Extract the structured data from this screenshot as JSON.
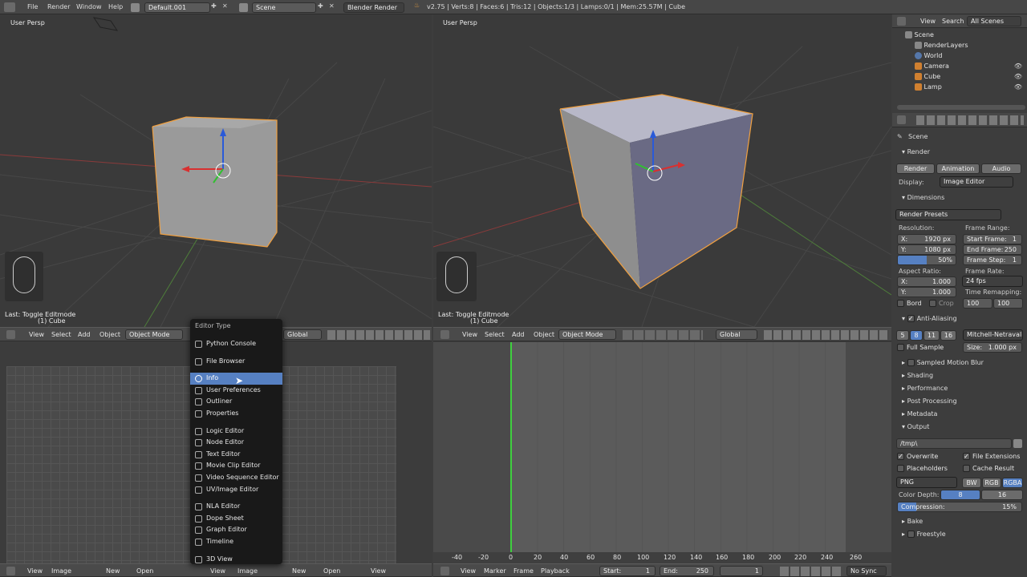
{
  "topbar": {
    "menus": [
      "File",
      "Render",
      "Window",
      "Help"
    ],
    "layout": "Default.001",
    "scene": "Scene",
    "engine": "Blender Render",
    "stats": "v2.75 | Verts:8 | Faces:6 | Tris:12 | Objects:1/3 | Lamps:0/1 | Mem:25.57M | Cube"
  },
  "viewport_left": {
    "label": "User Persp",
    "last_op": "Last: Toggle Editmode",
    "obj": "(1) Cube",
    "header": {
      "items": [
        "View",
        "Select",
        "Add",
        "Object"
      ],
      "mode": "Object Mode",
      "orient": "Global"
    }
  },
  "viewport_right": {
    "label": "User Persp",
    "last_op": "Last: Toggle Editmode",
    "obj": "(1) Cube",
    "header": {
      "items": [
        "View",
        "Select",
        "Add",
        "Object"
      ],
      "mode": "Object Mode",
      "orient": "Global"
    }
  },
  "image_editor": {
    "header": {
      "items": [
        "View",
        "Image",
        "New",
        "Open"
      ]
    }
  },
  "editor_menu": {
    "title": "Editor Type",
    "groups": [
      [
        "Python Console",
        "File Browser"
      ],
      [
        "Info",
        "User Preferences",
        "Outliner",
        "Properties"
      ],
      [
        "Logic Editor",
        "Node Editor",
        "Text Editor",
        "Movie Clip Editor",
        "Video Sequence Editor",
        "UV/Image Editor"
      ],
      [
        "NLA Editor",
        "Dope Sheet",
        "Graph Editor",
        "Timeline"
      ],
      [
        "3D View"
      ]
    ],
    "selected": "Info"
  },
  "bottom_mid_header": {
    "items": [
      "View",
      "Image",
      "New",
      "Open",
      "View"
    ]
  },
  "timeline": {
    "ticks": [
      "-40",
      "-20",
      "0",
      "20",
      "40",
      "60",
      "80",
      "100",
      "120",
      "140",
      "160",
      "180",
      "200",
      "220",
      "240",
      "260"
    ],
    "header": {
      "items": [
        "View",
        "Marker",
        "Frame",
        "Playback"
      ],
      "start_label": "Start:",
      "start": "1",
      "end_label": "End:",
      "end": "250",
      "current": "1",
      "sync": "No Sync"
    }
  },
  "outliner": {
    "tabs": [
      "View",
      "Search",
      "All Scenes"
    ],
    "items": [
      {
        "name": "Scene",
        "indent": 0
      },
      {
        "name": "RenderLayers",
        "indent": 1
      },
      {
        "name": "World",
        "indent": 1
      },
      {
        "name": "Camera",
        "indent": 1
      },
      {
        "name": "Cube",
        "indent": 1
      },
      {
        "name": "Lamp",
        "indent": 1
      }
    ]
  },
  "properties": {
    "breadcrumb": "Scene",
    "render": {
      "title": "Render",
      "buttons": [
        "Render",
        "Animation",
        "Audio"
      ],
      "display_label": "Display:",
      "display": "Image Editor"
    },
    "dimensions": {
      "title": "Dimensions",
      "presets": "Render Presets",
      "res_label": "Resolution:",
      "x": "X:",
      "x_val": "1920 px",
      "y": "Y:",
      "y_val": "1080 px",
      "pct": "50%",
      "frame_range_label": "Frame Range:",
      "start_frame": "Start Frame:",
      "start_frame_val": "1",
      "end_frame": "End Frame:",
      "end_frame_val": "250",
      "frame_step": "Frame Step:",
      "frame_step_val": "1",
      "aspect_label": "Aspect Ratio:",
      "ax": "X:",
      "ax_val": "1.000",
      "ay": "Y:",
      "ay_val": "1.000",
      "frame_rate_label": "Frame Rate:",
      "fps": "24 fps",
      "time_remap": "Time Remapping:",
      "old": "100",
      "new": "100",
      "bord": "Bord",
      "crop": "Crop"
    },
    "aa": {
      "title": "Anti-Aliasing",
      "samples": [
        "5",
        "8",
        "11",
        "16"
      ],
      "active": "8",
      "filter": "Mitchell-Netravali",
      "full_sample": "Full Sample",
      "size": "Size:",
      "size_val": "1.000 px"
    },
    "collapsed": [
      "Sampled Motion Blur",
      "Shading",
      "Performance",
      "Post Processing",
      "Metadata"
    ],
    "output": {
      "title": "Output",
      "path": "/tmp\\",
      "overwrite": "Overwrite",
      "file_ext": "File Extensions",
      "placeholders": "Placeholders",
      "cache": "Cache Result",
      "format": "PNG",
      "modes": [
        "BW",
        "RGB",
        "RGBA"
      ],
      "color_depth": "Color Depth:",
      "depth8": "8",
      "depth16": "16",
      "compression": "Compression:",
      "compression_val": "15%"
    },
    "bottom": [
      "Bake",
      "Freestyle"
    ]
  },
  "colors": {
    "accent": "#5680c2",
    "select": "#f0a040",
    "timeline_cursor": "#3fd03f"
  }
}
